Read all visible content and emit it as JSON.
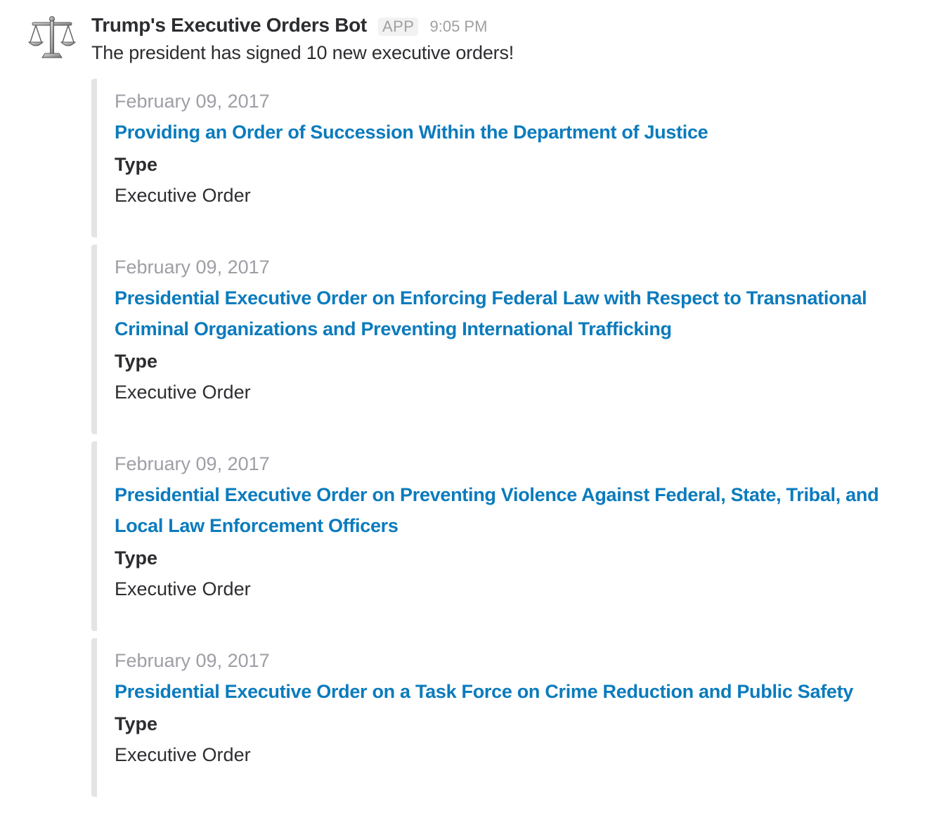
{
  "message": {
    "sender": "Trump's Executive Orders Bot",
    "badge": "APP",
    "time": "9:05 PM",
    "avatar_icon": "balance-scale-icon",
    "text": "The president has signed 10 new executive orders!"
  },
  "attachments": [
    {
      "date": "February 09, 2017",
      "title": "Providing an Order of Succession Within the Department of Justice",
      "field_label": "Type",
      "field_value": "Executive Order"
    },
    {
      "date": "February 09, 2017",
      "title": "Presidential Executive Order on Enforcing Federal Law with Respect to Transnational Criminal Organizations and Preventing International Trafficking",
      "field_label": "Type",
      "field_value": "Executive Order"
    },
    {
      "date": "February 09, 2017",
      "title": "Presidential Executive Order on Preventing Violence Against Federal, State, Tribal, and Local Law Enforcement Officers",
      "field_label": "Type",
      "field_value": "Executive Order"
    },
    {
      "date": "February 09, 2017",
      "title": "Presidential Executive Order on a Task Force on Crime Reduction and Public Safety",
      "field_label": "Type",
      "field_value": "Executive Order"
    }
  ],
  "colors": {
    "link": "#0b7bbd",
    "attachment_bar": "#e3e4e6",
    "muted": "#9e9ea6",
    "text": "#2c2d30"
  }
}
